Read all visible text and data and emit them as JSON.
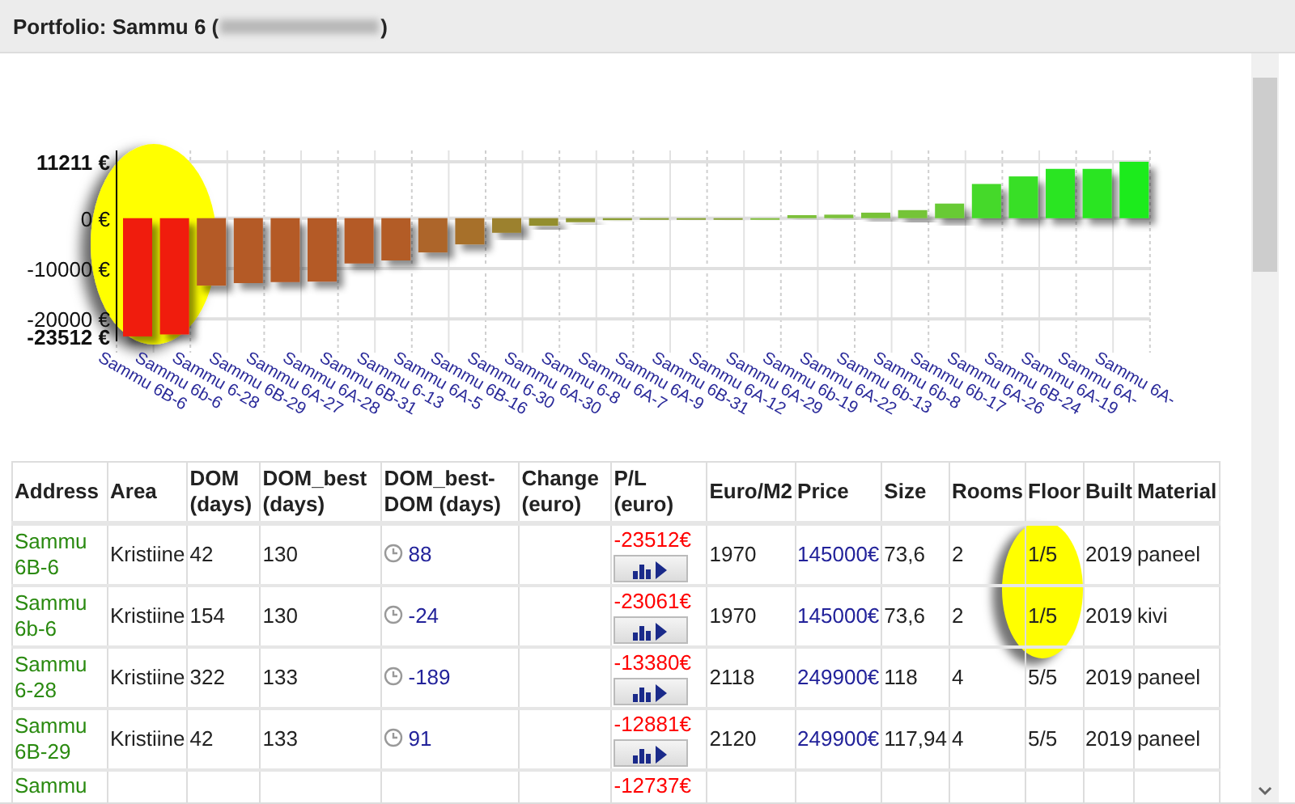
{
  "panel": {
    "title": "Portfolio: Sammu 6 (",
    "title_blurred": true,
    "title_end": ")"
  },
  "chart": {
    "chart_data": {
      "type": "bar",
      "categories": [
        "Sammu 6B-6",
        "Sammu 6b-6",
        "Sammu 6-28",
        "Sammu 6B-29",
        "Sammu 6A-27",
        "Sammu 6A-28",
        "Sammu 6B-31",
        "Sammu 6-13",
        "Sammu 6A-5",
        "Sammu 6B-16",
        "Sammu 6-30",
        "Sammu 6A-30",
        "Sammu 6-8",
        "Sammu 6A-7",
        "Sammu 6A-9",
        "Sammu 6B-31",
        "Sammu 6A-12",
        "Sammu 6A-29",
        "Sammu 6b-19",
        "Sammu 6A-22",
        "Sammu 6b-13",
        "Sammu 6b-8",
        "Sammu 6b-17",
        "Sammu 6A-26",
        "Sammu 6B-24",
        "Sammu 6A-19",
        "Sammu 6A-",
        "Sammu 6A-"
      ],
      "grid": true,
      "series": [
        {
          "values": [
            -23500,
            -23100,
            -13400,
            -12900,
            -12700,
            -12600,
            -9000,
            -8400,
            -6800,
            -5200,
            -2900,
            -1500,
            -800,
            -400,
            -300,
            -200,
            -150,
            0,
            600,
            700,
            1100,
            1600,
            2900,
            6800,
            8300,
            9800,
            9800,
            11211
          ]
        }
      ],
      "ylim": [
        -23512,
        11211
      ],
      "yticks": [
        {
          "value": 11211,
          "label": "11211 €"
        },
        {
          "value": 0,
          "label": "0 €"
        },
        {
          "value": -10000,
          "label": "-10000 €"
        },
        {
          "value": -20000,
          "label": "-20000 €"
        },
        {
          "value": -23512,
          "label": "-23512 €"
        }
      ]
    }
  },
  "table": {
    "columns": [
      "Address",
      "Area",
      "DOM (days)",
      "DOM_best (days)",
      "DOM_best-DOM (days)",
      "Change (euro)",
      "P/L (euro)",
      "Euro/M2",
      "Price",
      "Size",
      "Rooms",
      "Floor",
      "Built",
      "Material"
    ],
    "rows": [
      {
        "address": "Sammu 6B-6",
        "area": "Kristiine",
        "dom": "42",
        "dom_best": "130",
        "dom_diff": "88",
        "pl": "-23512€",
        "euro_m2": "1970",
        "price": "145000€",
        "size": "73,6",
        "rooms": "2",
        "floor": "1/5",
        "built": "2019",
        "material": "paneel"
      },
      {
        "address": "Sammu 6b-6",
        "area": "Kristiine",
        "dom": "154",
        "dom_best": "130",
        "dom_diff": "-24",
        "pl": "-23061€",
        "euro_m2": "1970",
        "price": "145000€",
        "size": "73,6",
        "rooms": "2",
        "floor": "1/5",
        "built": "2019",
        "material": "kivi"
      },
      {
        "address": "Sammu 6-28",
        "area": "Kristiine",
        "dom": "322",
        "dom_best": "133",
        "dom_diff": "-189",
        "pl": "-13380€",
        "euro_m2": "2118",
        "price": "249900€",
        "size": "118",
        "rooms": "4",
        "floor": "5/5",
        "built": "2019",
        "material": "paneel"
      },
      {
        "address": "Sammu 6B-29",
        "area": "Kristiine",
        "dom": "42",
        "dom_best": "133",
        "dom_diff": "91",
        "pl": "-12881€",
        "euro_m2": "2120",
        "price": "249900€",
        "size": "117,94",
        "rooms": "4",
        "floor": "5/5",
        "built": "2019",
        "material": "paneel"
      },
      {
        "address": "Sammu",
        "pl": "-12737€"
      }
    ]
  }
}
